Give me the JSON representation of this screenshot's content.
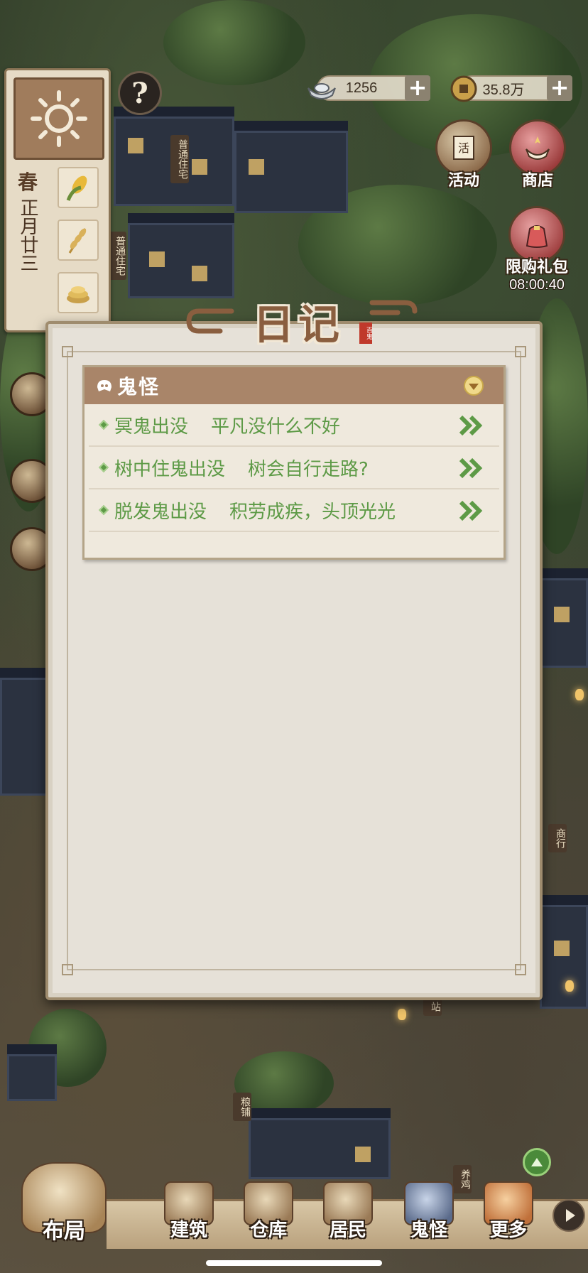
{
  "season_panel": {
    "season": "春",
    "date": "正月廿三",
    "weather_icon": "sun-icon",
    "crop_icons": [
      "corn-icon",
      "wheat-icon",
      "coins-icon"
    ]
  },
  "help_icon": "question-icon",
  "currencies": [
    {
      "icon": "silver-ingot-icon",
      "value": "1256"
    },
    {
      "icon": "copper-coin-icon",
      "value": "35.8万"
    }
  ],
  "side_buttons": {
    "activity": "活动",
    "shop": "商店",
    "limited_pack": "限购礼包",
    "limited_timer": "08:00:40"
  },
  "map_signs": [
    "普通住宅",
    "普通住宅",
    "商行",
    "粮铺",
    "站",
    "养鸡"
  ],
  "diary": {
    "title": "日记",
    "seal": "百鬼",
    "category": {
      "title": "鬼怪",
      "entries": [
        {
          "name": "冥鬼出没",
          "desc": "平凡没什么不好"
        },
        {
          "name": "树中住鬼出没",
          "desc": "树会自行走路?"
        },
        {
          "name": "脱发鬼出没",
          "desc": "积劳成疾，头顶光光"
        }
      ]
    }
  },
  "bottom_nav": {
    "layout": "布局",
    "build": "建筑",
    "warehouse": "仓库",
    "residents": "居民",
    "ghosts": "鬼怪",
    "more": "更多"
  },
  "colors": {
    "entry_green": "#5d9a46",
    "category_header": "#a98569",
    "panel_bg": "#e6e1d8"
  }
}
